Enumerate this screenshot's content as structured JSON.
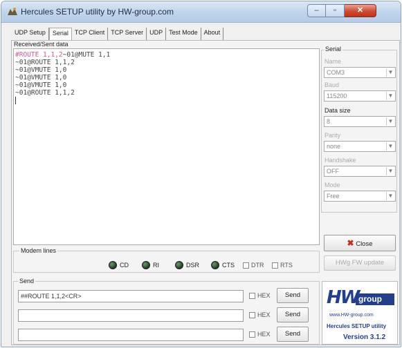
{
  "window": {
    "title": "Hercules SETUP utility by HW-group.com",
    "buttons": {
      "minimize": "–",
      "maximize": "▫",
      "close": "✕"
    }
  },
  "tabs": [
    {
      "label": "UDP Setup",
      "active": false
    },
    {
      "label": "Serial",
      "active": true
    },
    {
      "label": "TCP Client",
      "active": false
    },
    {
      "label": "TCP Server",
      "active": false
    },
    {
      "label": "UDP",
      "active": false
    },
    {
      "label": "Test Mode",
      "active": false
    },
    {
      "label": "About",
      "active": false
    }
  ],
  "received": {
    "group_label": "Received/Sent data",
    "first_line_sent": "#ROUTE 1,1,2",
    "first_line_received": "~01@MUTE 1,1",
    "lines": [
      "~01@ROUTE 1,1,2",
      "~01@VMUTE 1,0",
      "~01@VMUTE 1,0",
      "~01@VMUTE 1,0",
      "~01@ROUTE 1,1,2"
    ]
  },
  "serial": {
    "group_label": "Serial",
    "name_label": "Name",
    "name_value": "COM3",
    "baud_label": "Baud",
    "baud_value": "115200",
    "data_size_label": "Data size",
    "data_size_value": "8",
    "parity_label": "Parity",
    "parity_value": "none",
    "handshake_label": "Handshake",
    "handshake_value": "OFF",
    "mode_label": "Mode",
    "mode_value": "Free",
    "close_label": "Close",
    "update_label": "HWg FW update"
  },
  "modem": {
    "group_label": "Modem lines",
    "leds": [
      "CD",
      "RI",
      "DSR",
      "CTS"
    ],
    "checks": [
      "DTR",
      "RTS"
    ]
  },
  "send": {
    "group_label": "Send",
    "rows": [
      {
        "value": "##ROUTE 1,1,2<CR>",
        "hex_label": "HEX",
        "button": "Send"
      },
      {
        "value": "",
        "hex_label": "HEX",
        "button": "Send"
      },
      {
        "value": "",
        "hex_label": "HEX",
        "button": "Send"
      }
    ]
  },
  "logo": {
    "hw": "HW",
    "group": "group",
    "url": "www.HW-group.com",
    "product": "Hercules SETUP utility",
    "version": "Version 3.1.2"
  },
  "colors": {
    "sent_text": "#d0569c",
    "received_text": "#444444",
    "brand_blue": "#233f8c",
    "close_red": "#c0311b"
  }
}
